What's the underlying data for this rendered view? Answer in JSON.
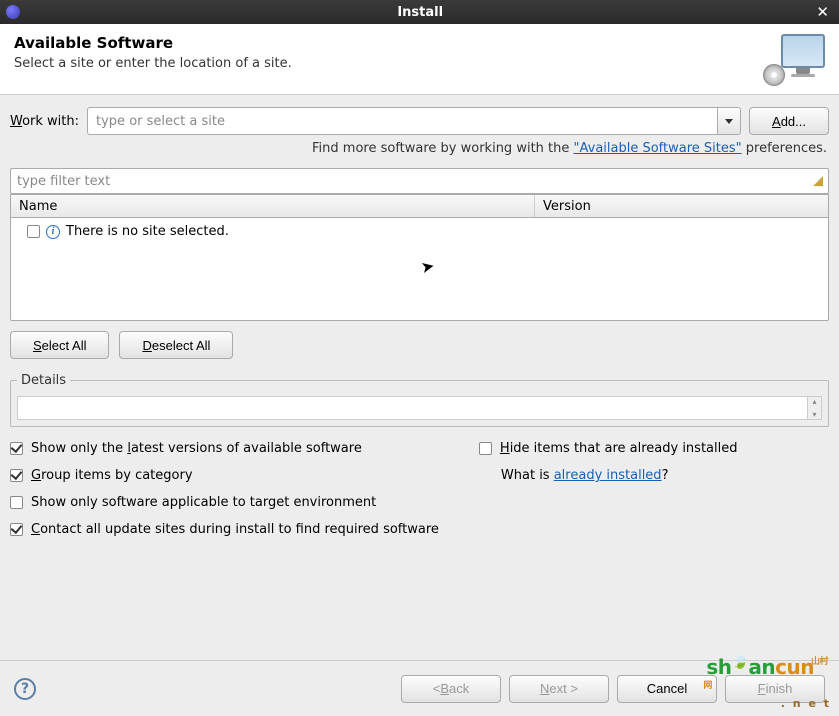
{
  "titlebar": {
    "title": "Install"
  },
  "header": {
    "title": "Available Software",
    "subtitle": "Select a site or enter the location of a site."
  },
  "workwith": {
    "label_pre": "W",
    "label_post": "ork with:",
    "placeholder": "type or select a site",
    "add_label_pre": "A",
    "add_label_post": "dd..."
  },
  "hint": {
    "prefix": "Find more software by working with the ",
    "link": "\"Available Software Sites\"",
    "suffix": " preferences."
  },
  "filter": {
    "placeholder": "type filter text"
  },
  "table": {
    "col_name": "Name",
    "col_version": "Version",
    "empty_msg": "There is no site selected."
  },
  "buttons": {
    "select_all_pre": "S",
    "select_all_post": "elect All",
    "deselect_all_pre": "D",
    "deselect_all_post": "eselect All"
  },
  "details": {
    "legend": "Details"
  },
  "options": {
    "latest_pre": "Show only the ",
    "latest_u": "l",
    "latest_post": "atest versions of available software",
    "group_pre": "G",
    "group_post": "roup items by category",
    "applicable": "Show only software applicable to target environment",
    "contact_pre": "C",
    "contact_post": "ontact all update sites during install to find required software",
    "hide_pre": "H",
    "hide_post": "ide items that are already installed",
    "what_prefix": "What is ",
    "what_link": "already installed",
    "what_suffix": "?"
  },
  "footer": {
    "back_pre": "< ",
    "back_u": "B",
    "back_post": "ack",
    "next_pre": "N",
    "next_post": "ext >",
    "cancel": "Cancel",
    "finish_pre": "F",
    "finish_post": "inish"
  },
  "checked": {
    "latest": true,
    "group": true,
    "applicable": false,
    "contact": true,
    "hide": false
  }
}
